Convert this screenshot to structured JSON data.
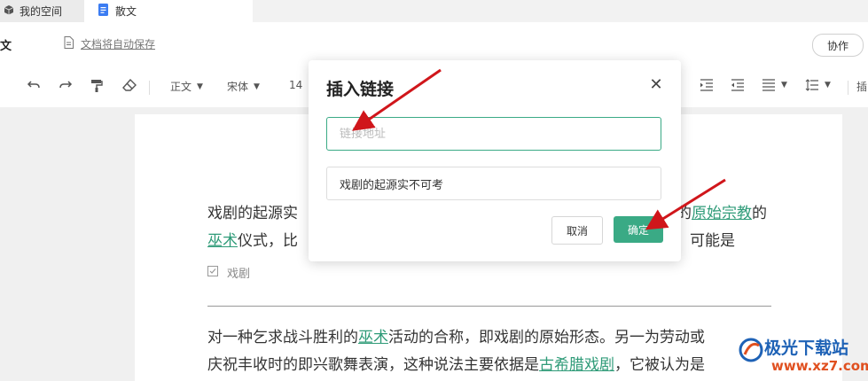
{
  "tabs": [
    {
      "label": "我的空间",
      "icon": "cube-icon"
    },
    {
      "label": "散文",
      "icon": "document-icon"
    }
  ],
  "header": {
    "doc_title": "文",
    "autosave_label": "文档将自动保存",
    "collab_label": "协作"
  },
  "toolbar": {
    "style_label": "正文",
    "font_label": "宋体",
    "size_label": "14",
    "insert_label": "插"
  },
  "document": {
    "para1_line1_a": "戏剧的起源实",
    "para1_line1_b": "的",
    "para1_line1_link": "原始宗教",
    "para1_line1_c": "的",
    "para1_line2_link": "巫术",
    "para1_line2_a": "仪式，比",
    "para1_line2_b": "可能是",
    "tag_label": "戏剧",
    "para2_line1_a": "对一种乞求战斗胜利的",
    "para2_line1_link": "巫术",
    "para2_line1_b": "活动的合称，即戏剧的原始形态。另一为劳动或",
    "para2_line2_a": "庆祝丰收时的即兴歌舞表演，这种说法主要依据是",
    "para2_line2_link": "古希腊戏剧",
    "para2_line2_b": "，它被认为是"
  },
  "dialog": {
    "title": "插入链接",
    "url_placeholder": "链接地址",
    "text_value": "戏剧的起源实不可考",
    "cancel_label": "取消",
    "ok_label": "确定"
  },
  "watermark": {
    "name": "极光下载站",
    "url": "www.xz7.com"
  },
  "colors": {
    "accent": "#3aaa85",
    "link": "#2f9b78",
    "arrow": "#d0161b"
  }
}
